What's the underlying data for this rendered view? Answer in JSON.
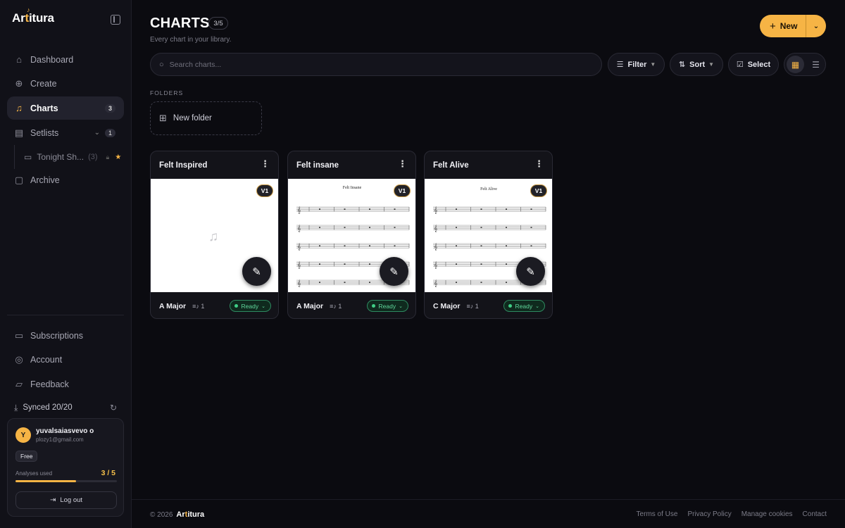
{
  "brand": {
    "name_prefix": "Ar",
    "name_accent": "t",
    "name_suffix": "itura",
    "accent_color": "#f6b445"
  },
  "sidebar": {
    "nav": [
      {
        "label": "Dashboard",
        "icon": "home-icon"
      },
      {
        "label": "Create",
        "icon": "plus-circle-icon"
      },
      {
        "label": "Charts",
        "icon": "music-note-icon",
        "badge": "3",
        "active": true
      },
      {
        "label": "Setlists",
        "icon": "setlist-icon",
        "badge": "1"
      },
      {
        "label": "Archive",
        "icon": "lock-icon"
      }
    ],
    "setlist_sub": {
      "label": "Tonight Sh...",
      "count": "(3)"
    },
    "bottom_nav": [
      {
        "label": "Subscriptions",
        "icon": "card-icon"
      },
      {
        "label": "Account",
        "icon": "user-circle-icon"
      },
      {
        "label": "Feedback",
        "icon": "chat-icon"
      }
    ],
    "sync": {
      "label": "Synced 20/20"
    },
    "user": {
      "initial": "Y",
      "name": "yuvalsaiasvevo o",
      "email": "plozy1@gmail.com",
      "plan": "Free",
      "usage_label": "Analyses used",
      "usage_value": "3 / 5",
      "usage_fraction": 0.6,
      "logout_label": "Log out"
    }
  },
  "header": {
    "title": "CHARTS",
    "count": "3/5",
    "subtitle": "Every chart in your library.",
    "new_label": "New"
  },
  "toolbar": {
    "search_placeholder": "Search charts...",
    "filter_label": "Filter",
    "sort_label": "Sort",
    "select_label": "Select"
  },
  "folders": {
    "section_label": "FOLDERS",
    "new_folder_label": "New folder"
  },
  "charts": [
    {
      "title": "Felt Inspired",
      "version": "V1",
      "key": "A Major",
      "sections": "1",
      "status": "Ready",
      "preview": "empty"
    },
    {
      "title": "Felt insane",
      "version": "V1",
      "key": "A Major",
      "sections": "1",
      "status": "Ready",
      "preview": "sheet",
      "sheet_title": "Felt Insane"
    },
    {
      "title": "Felt Alive",
      "version": "V1",
      "key": "C Major",
      "sections": "1",
      "status": "Ready",
      "preview": "sheet",
      "sheet_title": "Felt Alive"
    }
  ],
  "footer": {
    "copyright": "© 2026",
    "links": [
      "Terms of Use",
      "Privacy Policy",
      "Manage cookies",
      "Contact"
    ]
  }
}
